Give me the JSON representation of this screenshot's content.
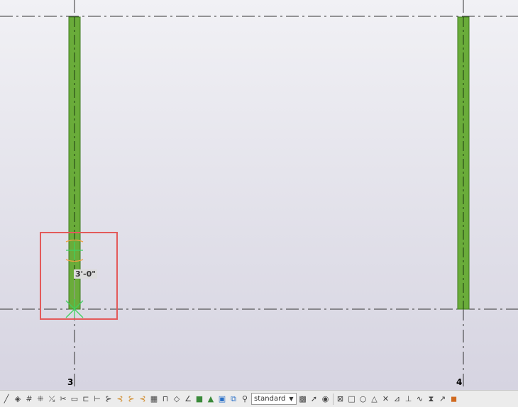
{
  "grid": {
    "label_3": "3",
    "label_4": "4"
  },
  "dimension": {
    "value": "3'-0\""
  },
  "colors": {
    "member_fill": "#6aac3a",
    "member_stroke": "#3e7a1f",
    "selection_border": "#e35a5a",
    "handle_orange": "#f0a040",
    "handle_green": "#40d060"
  },
  "toolbar": {
    "view_select_value": "standard",
    "icons_left": [
      "line-icon",
      "cube-icon",
      "grid-icon",
      "grid-dots-icon",
      "snap-icon",
      "scissors-icon",
      "rectangle-icon",
      "align-icon",
      "measure-icon",
      "offset-icon",
      "snap-end-icon",
      "snap-mid-icon",
      "snap-perp-icon",
      "fill-icon",
      "column-icon",
      "layer-icon",
      "angle-icon",
      "green-square-icon",
      "tree-icon",
      "blue-grid-icon",
      "group-icon",
      "pin-icon"
    ],
    "icons_right": [
      "pattern-icon",
      "pointer-icon",
      "eye-icon",
      "box-x-icon",
      "square-icon",
      "circle-icon",
      "triangle-icon",
      "cross-icon",
      "corner-icon",
      "dimension-icon",
      "wave-icon",
      "hourglass-icon",
      "arrow-icon",
      "stop-icon"
    ]
  }
}
